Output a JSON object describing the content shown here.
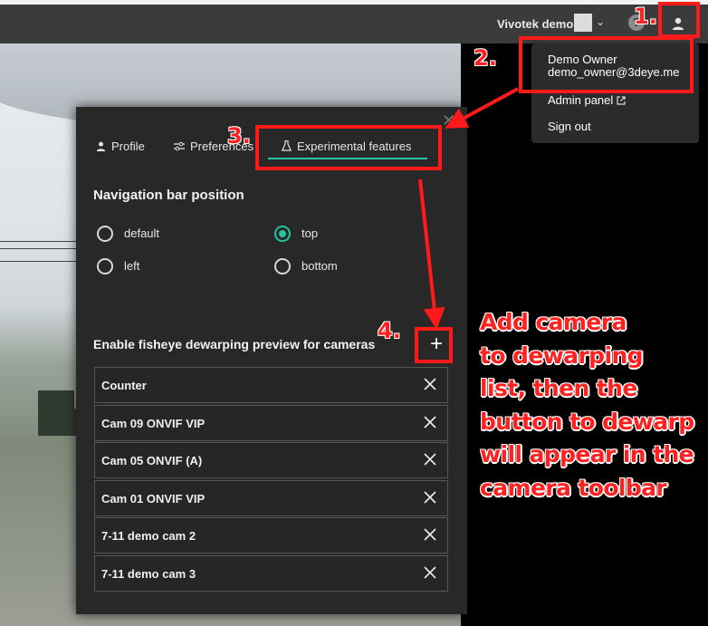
{
  "topbar": {
    "site_name": "Vivotek demo",
    "help_icon": "help-circle-icon",
    "user_icon": "user-icon"
  },
  "user_menu": {
    "name": "Demo Owner",
    "email": "demo_owner@3deye.me",
    "items": [
      {
        "label": "Admin panel",
        "icon": "external-link-icon"
      },
      {
        "label": "Sign out"
      }
    ]
  },
  "settings": {
    "tabs": [
      {
        "label": "Profile",
        "icon": "user-icon"
      },
      {
        "label": "Preferences",
        "icon": "sliders-icon"
      },
      {
        "label": "Experimental features",
        "icon": "flask-icon",
        "active": true
      }
    ],
    "nav_bar": {
      "title": "Navigation bar position",
      "options": [
        {
          "label": "default",
          "selected": false
        },
        {
          "label": "top",
          "selected": true
        },
        {
          "label": "left",
          "selected": false
        },
        {
          "label": "bottom",
          "selected": false
        }
      ]
    },
    "fisheye": {
      "title": "Enable fisheye dewarping preview for cameras",
      "add_label": "+",
      "cameras": [
        "Counter",
        "Cam 09 ONVIF VIP",
        "Cam 05 ONVIF (A)",
        "Cam 01 ONVIF VIP",
        "7-11 demo cam 2",
        "7-11 demo cam 3"
      ]
    }
  },
  "annotations": {
    "steps": [
      "1.",
      "2.",
      "3.",
      "4."
    ],
    "callout": [
      "Add camera",
      "to dewarping",
      "list, then the",
      "button to dewarp",
      "will appear in the",
      "camera toolbar"
    ]
  },
  "colors": {
    "accent": "#23c4a2",
    "annotation_red": "#ff1a1a",
    "panel_bg": "#282828",
    "topbar_bg": "#3b3b3b"
  }
}
